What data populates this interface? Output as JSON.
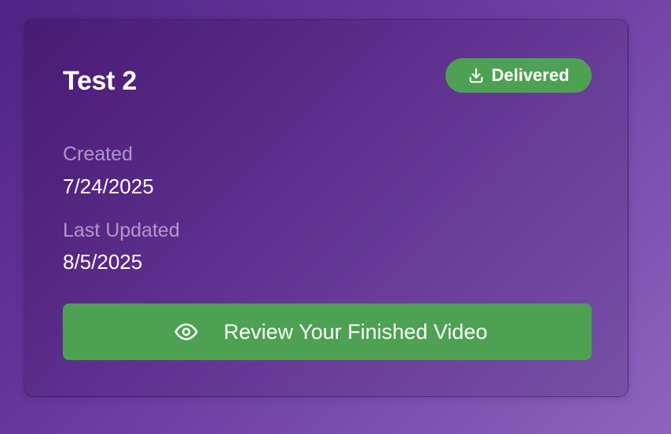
{
  "project": {
    "title": "Test 2",
    "status": {
      "label": "Delivered",
      "icon": "download-icon",
      "color": "#4ea152"
    },
    "created_label": "Created",
    "created_value": "7/24/2025",
    "updated_label": "Last Updated",
    "updated_value": "8/5/2025",
    "action": {
      "label": "Review Your Finished Video",
      "icon": "eye-icon",
      "color": "#4ea152"
    }
  }
}
